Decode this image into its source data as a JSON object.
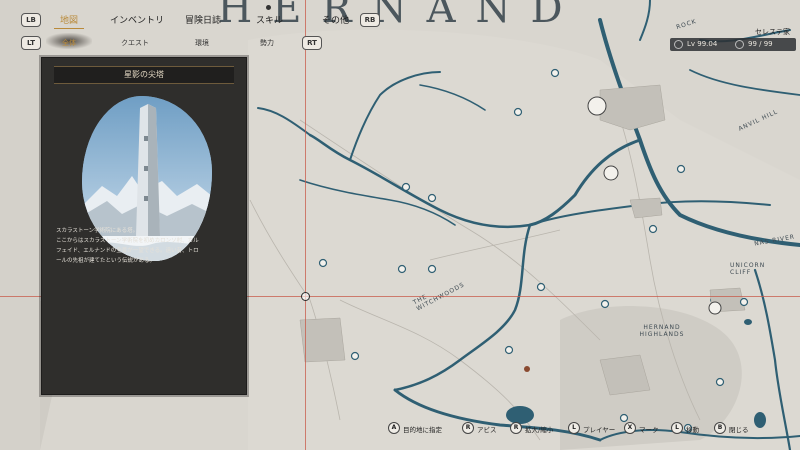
{
  "map": {
    "title": "HERNAND",
    "labels": {
      "anvil_hill": "ANVIL HILL",
      "nas_river": "NAS RIVER",
      "unicorn_cliff": "UNICORN CLIFF",
      "hernand_highlands": "HERNAND HIGHLANDS",
      "the_witchwoods": "THE WITCHWOODS",
      "rock": "ROCK"
    }
  },
  "top_menu": {
    "lb": "LB",
    "rb": "RB",
    "lt": "LT",
    "rt": "RT",
    "tabs": [
      {
        "label": "地図",
        "active": true
      },
      {
        "label": "インベントリ",
        "active": false
      },
      {
        "label": "冒険日誌",
        "active": false
      },
      {
        "label": "スキル",
        "active": false
      },
      {
        "label": "その他",
        "active": false
      }
    ],
    "sub_tabs": [
      {
        "label": "全体",
        "active": true
      },
      {
        "label": "クエスト",
        "active": false
      },
      {
        "label": "環境",
        "active": false
      },
      {
        "label": "勢力",
        "active": false
      }
    ]
  },
  "status": {
    "house_name": "セレステ家",
    "level_text": "Lv 99.04",
    "hp_text": "99 / 99"
  },
  "info_panel": {
    "title": "星影の尖塔",
    "description": [
      "スカラストーン学術院にある塔。",
      "ここからはスカラストーン学術院を初めカロンソ村、カル",
      "フェイド、エルナンドの全景が一望できる。遠い昔、トロ",
      "ールの先祖が建てたという伝説がある。"
    ]
  },
  "hints": [
    {
      "button": "A",
      "label": "目的地に指定"
    },
    {
      "button": "R",
      "label": "アビス"
    },
    {
      "button": "R",
      "label": "拡大/縮小"
    },
    {
      "button": "L",
      "label": "プレイヤー"
    },
    {
      "button": "X",
      "label": "マーク"
    },
    {
      "button": "L",
      "label": "移動"
    },
    {
      "button": "B",
      "label": "閉じる"
    }
  ],
  "colors": {
    "map_background": "#d9d6cf",
    "river": "#2f5f73",
    "accent_gold": "#b98a3a",
    "panel_background": "#2f2e2c",
    "crosshair": "#c85a4a"
  }
}
